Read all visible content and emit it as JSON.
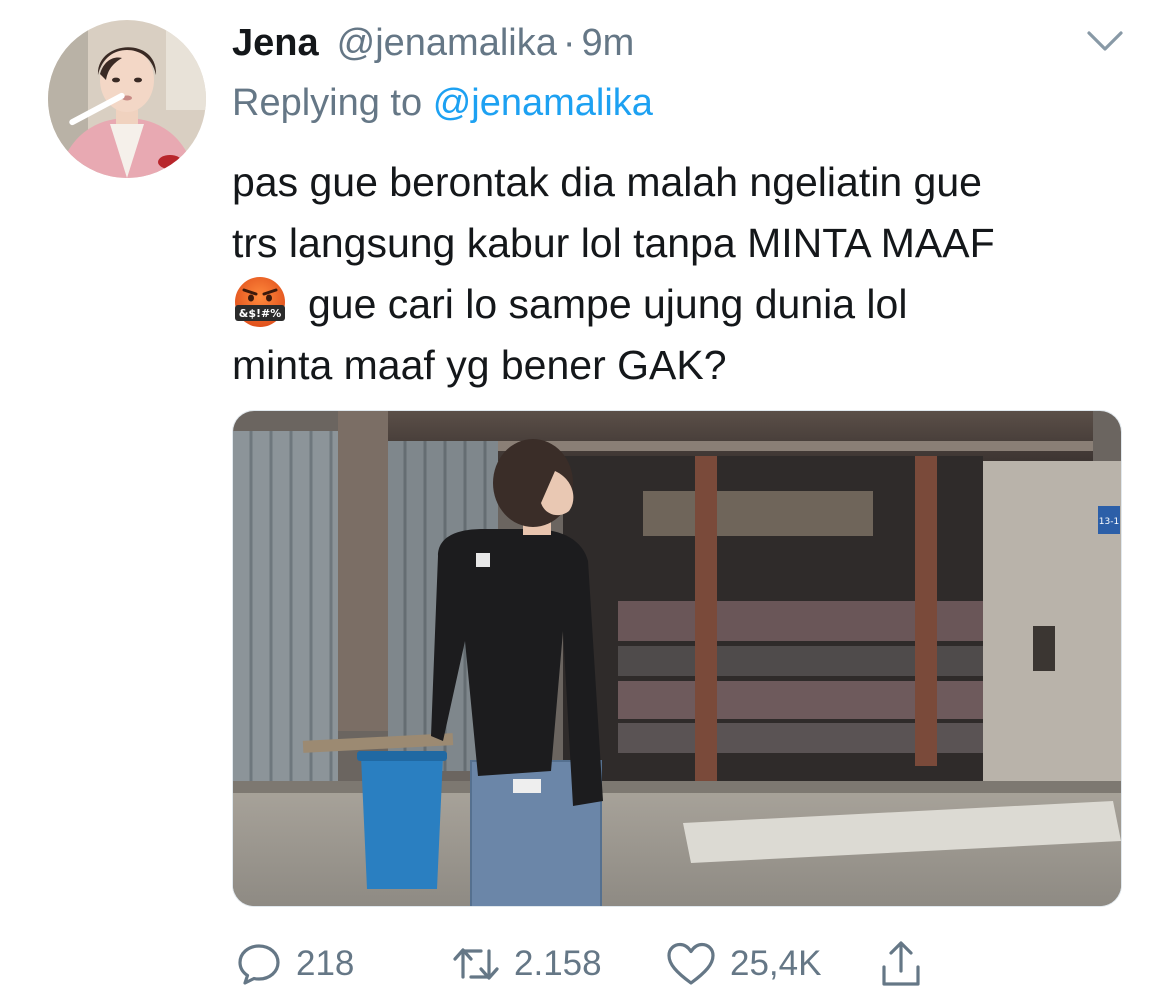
{
  "tweet": {
    "author": {
      "display_name": "Jena",
      "handle": "@jenamalika"
    },
    "separator": "·",
    "time": "9m",
    "replying_prefix": "Replying to",
    "replying_handle": "@jenamalika",
    "text_lines": [
      "pas gue berontak dia malah ngeliatin gue",
      "trs langsung kabur lol tanpa MINTA MAAF",
      "gue cari lo sampe ujung dunia lol",
      "minta maaf yg bener GAK?"
    ],
    "emoji": "face-with-symbols-on-mouth-emoji",
    "emoji_symbol_text": "&$!#%",
    "photo_sign_text": "13-1",
    "stats": {
      "replies": "218",
      "retweets": "2.158",
      "likes": "25,4K"
    }
  },
  "icons": {
    "more": "chevron-down-icon",
    "reply": "speech-bubble-icon",
    "retweet": "retweet-icon",
    "like": "heart-icon",
    "share": "share-icon"
  },
  "colors": {
    "text": "#14171a",
    "secondary": "#657786",
    "link": "#1da1f2",
    "border": "#e1e8ed"
  }
}
